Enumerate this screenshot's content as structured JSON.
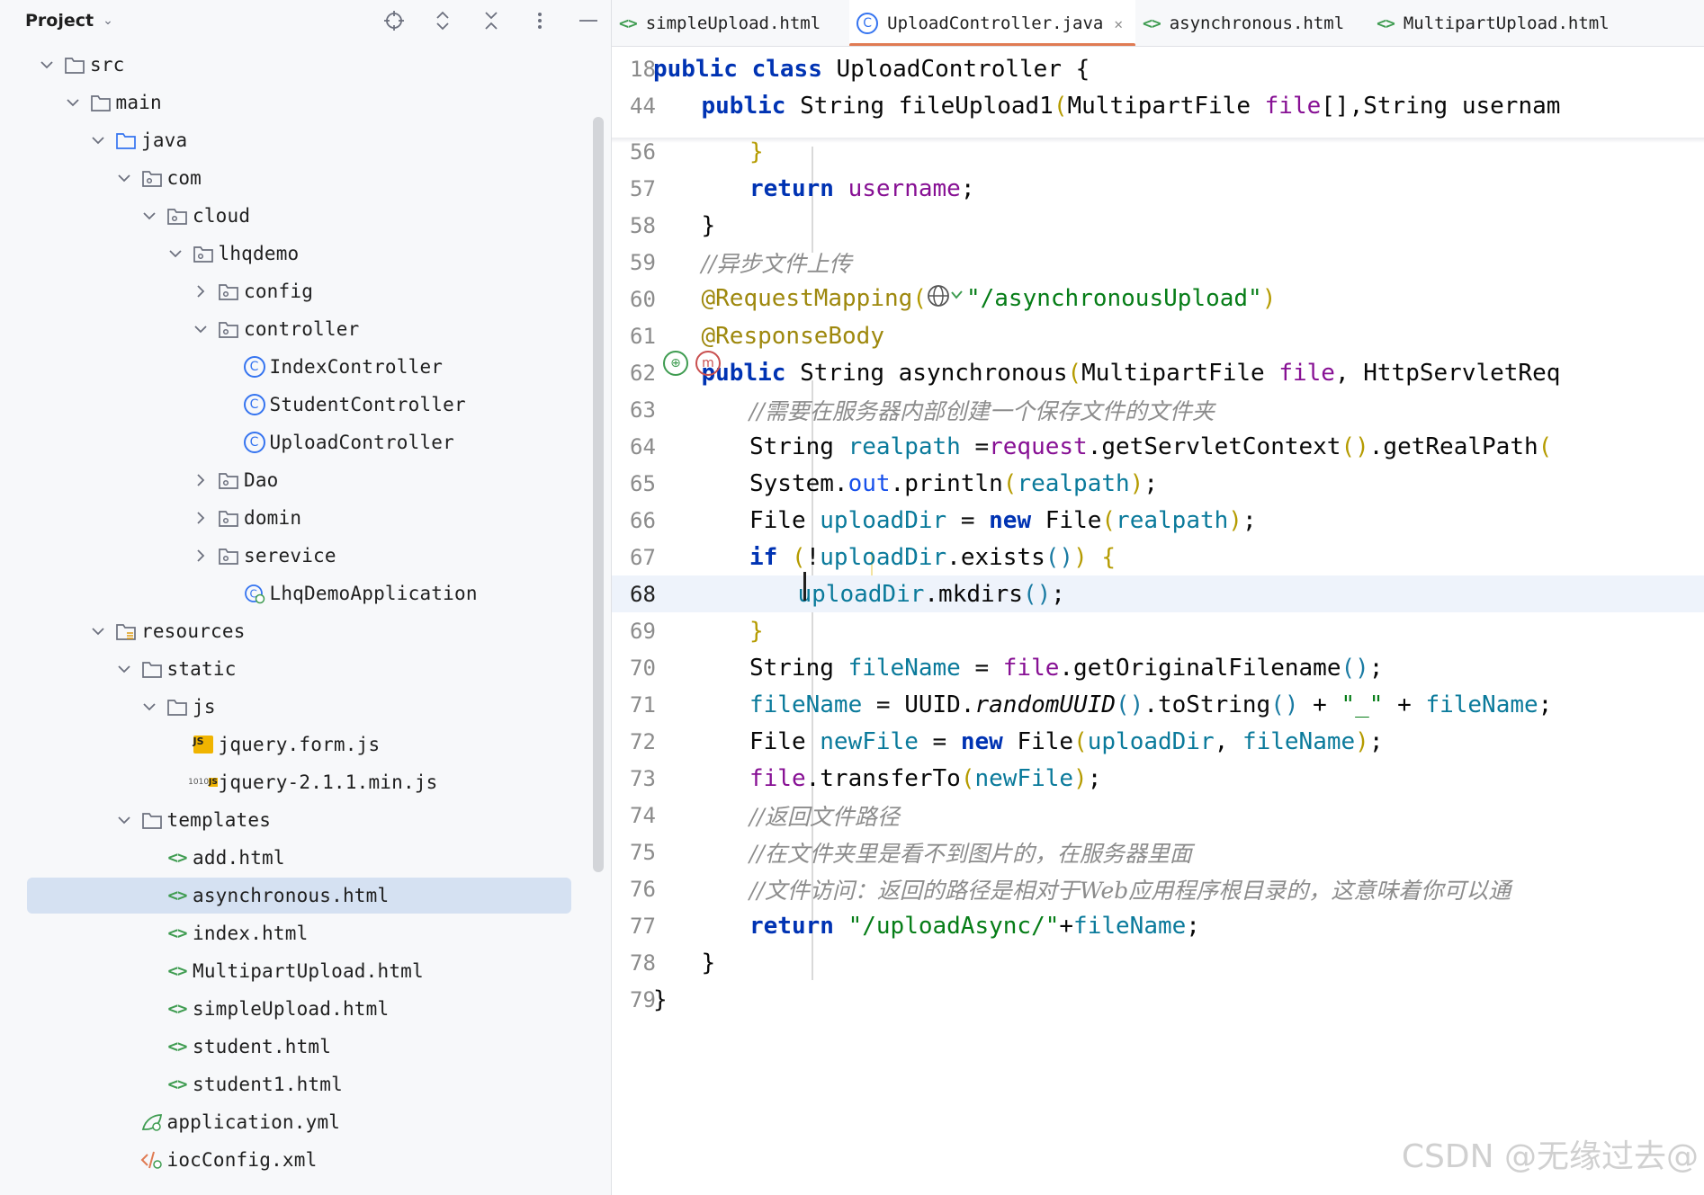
{
  "project_panel": {
    "title": "Project",
    "tree": [
      {
        "label": "src",
        "type": "folder",
        "indent": 0,
        "expanded": true
      },
      {
        "label": "main",
        "type": "folder",
        "indent": 1,
        "expanded": true
      },
      {
        "label": "java",
        "type": "folder-source",
        "indent": 2,
        "expanded": true
      },
      {
        "label": "com",
        "type": "package",
        "indent": 3,
        "expanded": true
      },
      {
        "label": "cloud",
        "type": "package",
        "indent": 4,
        "expanded": true
      },
      {
        "label": "lhqdemo",
        "type": "package",
        "indent": 5,
        "expanded": true
      },
      {
        "label": "config",
        "type": "package",
        "indent": 6,
        "expanded": false
      },
      {
        "label": "controller",
        "type": "package",
        "indent": 6,
        "expanded": true
      },
      {
        "label": "IndexController",
        "type": "class",
        "indent": 7
      },
      {
        "label": "StudentController",
        "type": "class",
        "indent": 7
      },
      {
        "label": "UploadController",
        "type": "class",
        "indent": 7
      },
      {
        "label": "Dao",
        "type": "package",
        "indent": 6,
        "expanded": false
      },
      {
        "label": "domin",
        "type": "package",
        "indent": 6,
        "expanded": false
      },
      {
        "label": "serevice",
        "type": "package",
        "indent": 6,
        "expanded": false
      },
      {
        "label": "LhqDemoApplication",
        "type": "spring-class",
        "indent": 7
      },
      {
        "label": "resources",
        "type": "folder-resources",
        "indent": 2,
        "expanded": true
      },
      {
        "label": "static",
        "type": "folder",
        "indent": 3,
        "expanded": true
      },
      {
        "label": "js",
        "type": "folder",
        "indent": 4,
        "expanded": true
      },
      {
        "label": "jquery.form.js",
        "type": "js",
        "indent": 5
      },
      {
        "label": "jquery-2.1.1.min.js",
        "type": "jsmin",
        "indent": 5
      },
      {
        "label": "templates",
        "type": "folder",
        "indent": 3,
        "expanded": true
      },
      {
        "label": "add.html",
        "type": "html",
        "indent": 4
      },
      {
        "label": "asynchronous.html",
        "type": "html",
        "indent": 4,
        "selected": true
      },
      {
        "label": "index.html",
        "type": "html",
        "indent": 4
      },
      {
        "label": "MultipartUpload.html",
        "type": "html",
        "indent": 4
      },
      {
        "label": "simpleUpload.html",
        "type": "html",
        "indent": 4
      },
      {
        "label": "student.html",
        "type": "html",
        "indent": 4
      },
      {
        "label": "student1.html",
        "type": "html",
        "indent": 4
      },
      {
        "label": "application.yml",
        "type": "yml",
        "indent": 3
      },
      {
        "label": "iocConfig.xml",
        "type": "xml",
        "indent": 3
      }
    ]
  },
  "tabs": [
    {
      "label": "simpleUpload.html",
      "icon": "html",
      "active": false
    },
    {
      "label": "UploadController.java",
      "icon": "class",
      "active": true,
      "closable": true
    },
    {
      "label": "asynchronous.html",
      "icon": "html",
      "active": false
    },
    {
      "label": "MultipartUpload.html",
      "icon": "html",
      "active": false
    }
  ],
  "editor": {
    "current_line": "68",
    "lines": [
      {
        "n": "18",
        "sticky": true
      },
      {
        "n": "44",
        "sticky": true
      },
      {
        "n": "56"
      },
      {
        "n": "57"
      },
      {
        "n": "58"
      },
      {
        "n": "59"
      },
      {
        "n": "60"
      },
      {
        "n": "61"
      },
      {
        "n": "62"
      },
      {
        "n": "63"
      },
      {
        "n": "64"
      },
      {
        "n": "65"
      },
      {
        "n": "66"
      },
      {
        "n": "67"
      },
      {
        "n": "68"
      },
      {
        "n": "69"
      },
      {
        "n": "70"
      },
      {
        "n": "71"
      },
      {
        "n": "72"
      },
      {
        "n": "73"
      },
      {
        "n": "74"
      },
      {
        "n": "75"
      },
      {
        "n": "76"
      },
      {
        "n": "77"
      },
      {
        "n": "78"
      },
      {
        "n": "79"
      }
    ],
    "tokens": {
      "l18": [
        "public",
        " ",
        "class",
        " UploadController ",
        "{"
      ],
      "l44": [
        "public",
        " String fileUpload1",
        "(",
        "MultipartFile ",
        "file",
        "[]",
        ",String ",
        "usernam"
      ],
      "l56": [
        "}"
      ],
      "l57": [
        "return",
        " ",
        "username",
        ";"
      ],
      "l58": [
        "}"
      ],
      "l59": [
        "//异步文件上传"
      ],
      "l60": [
        "@RequestMapping",
        "(",
        "\"/asynchronousUpload\"",
        ")"
      ],
      "l61": [
        "@ResponseBody"
      ],
      "l62": [
        "public",
        " String asynchronous",
        "(",
        "MultipartFile ",
        "file",
        ", HttpServletReq"
      ],
      "l63": [
        "//需要在服务器内部创建一个保存文件的文件夹"
      ],
      "l64": [
        "String ",
        "realpath",
        " =",
        "request",
        ".getServletContext",
        "()",
        ".getRealPath",
        "("
      ],
      "l65": [
        "System.",
        "out",
        ".println",
        "(",
        "realpath",
        ")",
        ";"
      ],
      "l66": [
        "File ",
        "uploadDir",
        " = ",
        "new",
        " File",
        "(",
        "realpath",
        ")",
        ";"
      ],
      "l67": [
        "if",
        " ",
        "(",
        "!",
        "uploadDir",
        ".exists",
        "()",
        ")",
        " ",
        "{"
      ],
      "l68": [
        "uploadDir",
        ".mkdirs",
        "()",
        ";"
      ],
      "l69": [
        "}"
      ],
      "l70": [
        "String ",
        "fileName",
        " = ",
        "file",
        ".getOriginalFilename",
        "()",
        ";"
      ],
      "l71": [
        "fileName",
        " = UUID.",
        "randomUUID",
        "()",
        ".toString",
        "()",
        " + ",
        "\"_\"",
        " + ",
        "fileName",
        ";"
      ],
      "l72": [
        "File ",
        "newFile",
        " = ",
        "new",
        " File",
        "(",
        "uploadDir",
        ", ",
        "fileName",
        ")",
        ";"
      ],
      "l73": [
        "file",
        ".transferTo",
        "(",
        "newFile",
        ")",
        ";"
      ],
      "l74": [
        "//返回文件路径"
      ],
      "l75": [
        "//在文件夹里是看不到图片的，在服务器里面"
      ],
      "l76": [
        "//文件访问：返回的路径是相对于Web应用程序根目录的，这意味着你可以通"
      ],
      "l77": [
        "return",
        " ",
        "\"/uploadAsync/\"",
        "+",
        "fileName",
        ";"
      ],
      "l78": [
        "}"
      ],
      "l79": [
        "}"
      ]
    }
  },
  "watermark": "CSDN @无缘过去@",
  "colors": {
    "keyword": "#0033b3",
    "string": "#067d17",
    "annotation": "#9e880d",
    "comment": "#8c8c8c",
    "field": "#1750eb",
    "parameter": "#871094",
    "selection": "#d5e1f2",
    "active_tab_underline": "#e07b53"
  }
}
